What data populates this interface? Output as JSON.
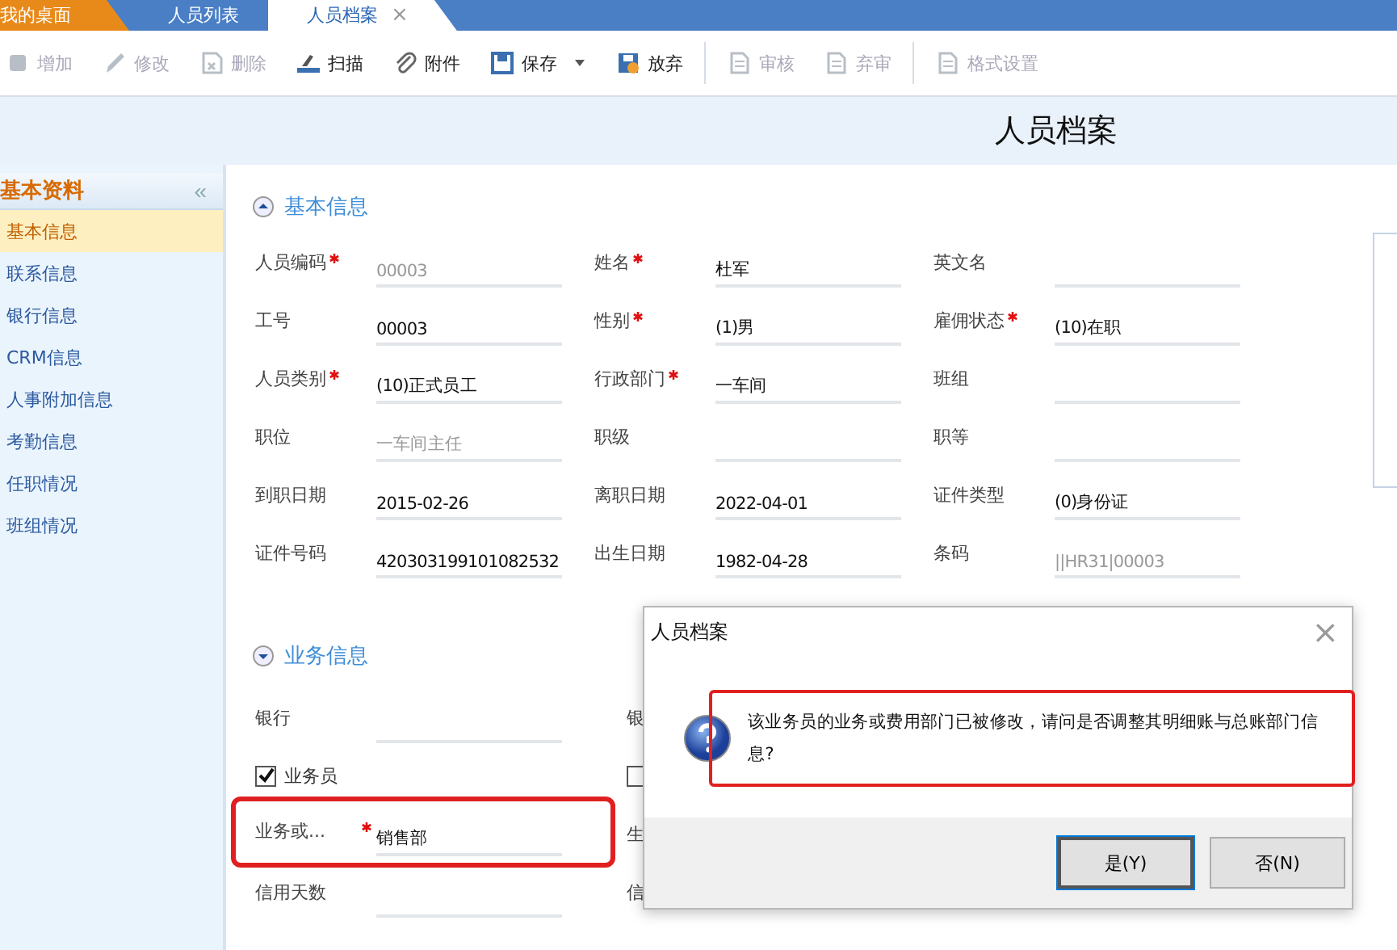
{
  "tabs": [
    {
      "label": "我的桌面",
      "kind": "home",
      "selected": false
    },
    {
      "label": "人员列表",
      "kind": "normal",
      "selected": false
    },
    {
      "label": "人员档案",
      "kind": "normal",
      "selected": true,
      "close": "×"
    }
  ],
  "toolbar": [
    {
      "label": "增加",
      "disabled": true
    },
    {
      "label": "修改",
      "disabled": true
    },
    {
      "label": "删除",
      "disabled": true
    },
    {
      "label": "扫描",
      "disabled": false
    },
    {
      "label": "附件",
      "disabled": false
    },
    {
      "label": "保存",
      "disabled": false,
      "dropdown": true
    },
    {
      "label": "放弃",
      "disabled": false,
      "separator_after": true
    },
    {
      "label": "审核",
      "disabled": true
    },
    {
      "label": "弃审",
      "disabled": true,
      "separator_after": true
    },
    {
      "label": "格式设置",
      "disabled": true
    }
  ],
  "page_title": "人员档案",
  "sidebar": {
    "title": "基本资料",
    "collapse": "«",
    "items": [
      {
        "label": "基本信息",
        "selected": true
      },
      {
        "label": "联系信息",
        "selected": false
      },
      {
        "label": "银行信息",
        "selected": false
      },
      {
        "label": "CRM信息",
        "selected": false
      },
      {
        "label": "人事附加信息",
        "selected": false
      },
      {
        "label": "考勤信息",
        "selected": false
      },
      {
        "label": "任职情况",
        "selected": false
      },
      {
        "label": "班组情况",
        "selected": false
      }
    ]
  },
  "basic": {
    "title": "基本信息",
    "expanded": true,
    "fields": [
      {
        "label": "人员编码",
        "required": true,
        "value": "00003",
        "disabled": true
      },
      {
        "label": "姓名",
        "required": true,
        "value": "杜军",
        "disabled": false
      },
      {
        "label": "英文名",
        "required": false
      },
      {
        "label": "工号",
        "required": false,
        "value": "00003",
        "disabled": false
      },
      {
        "label": "性别",
        "required": true,
        "value": "(1)男",
        "disabled": false
      },
      {
        "label": "雇佣状态",
        "required": true,
        "value": "(10)在职",
        "disabled": false
      },
      {
        "label": "人员类别",
        "required": true,
        "value": "(10)正式员工",
        "disabled": false
      },
      {
        "label": "行政部门",
        "required": true,
        "value": "一车间",
        "disabled": false
      },
      {
        "label": "班组",
        "required": false
      },
      {
        "label": "职位",
        "required": false,
        "value": "一车间主任",
        "disabled": true
      },
      {
        "label": "职级",
        "required": false
      },
      {
        "label": "职等",
        "required": false
      },
      {
        "label": "到职日期",
        "required": false,
        "value": "2015-02-26",
        "disabled": false
      },
      {
        "label": "离职日期",
        "required": false,
        "value": "2022-04-01",
        "disabled": false
      },
      {
        "label": "证件类型",
        "required": false,
        "value": "(0)身份证",
        "disabled": false
      },
      {
        "label": "证件号码",
        "required": false,
        "value": "420303199101082532",
        "disabled": false
      },
      {
        "label": "出生日期",
        "required": false,
        "value": "1982-04-28",
        "disabled": false
      },
      {
        "label": "条码",
        "required": false,
        "value": "||HR31|00003",
        "disabled": true
      }
    ]
  },
  "business": {
    "title": "业务信息",
    "expanded": false,
    "left": [
      {
        "kind": "field",
        "label": "银行",
        "required": false
      },
      {
        "kind": "checkbox",
        "label": "业务员",
        "checked": true
      },
      {
        "kind": "field",
        "label": "业务或...",
        "required": true,
        "value": "销售部",
        "highlighted": true
      },
      {
        "kind": "field",
        "label": "信用天数",
        "required": false
      }
    ],
    "right": [
      {
        "kind": "field",
        "label": "银"
      },
      {
        "kind": "checkbox",
        "checked": false
      },
      {
        "kind": "field",
        "label": "生"
      },
      {
        "kind": "field",
        "label": "信"
      }
    ]
  },
  "dialog": {
    "title": "人员档案",
    "close": "×",
    "message": "该业务员的业务或费用部门已被修改，请问是否调整其明细账与总账部门信息?",
    "highlighted": true,
    "buttons": [
      {
        "label": "是(Y)",
        "selected": true
      },
      {
        "label": "否(N)",
        "selected": false
      }
    ]
  }
}
